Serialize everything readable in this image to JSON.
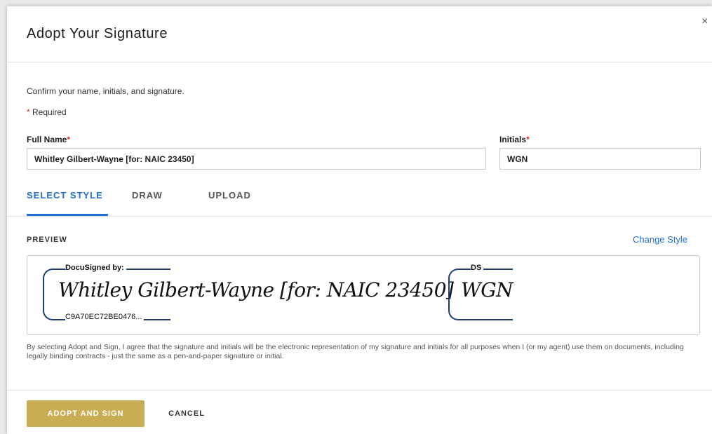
{
  "dialog": {
    "title": "Adopt Your Signature",
    "close_label": "×",
    "instructions": "Confirm your name, initials, and signature.",
    "required_star": "*",
    "required_label": " Required"
  },
  "form": {
    "full_name_label": "Full Name",
    "full_name_value": "Whitley Gilbert-Wayne [for: NAIC 23450]",
    "initials_label": "Initials",
    "initials_value": "WGN"
  },
  "tabs": [
    {
      "label": "SELECT STYLE",
      "active": true
    },
    {
      "label": "DRAW",
      "active": false
    },
    {
      "label": "UPLOAD",
      "active": false
    }
  ],
  "preview": {
    "label": "PREVIEW",
    "change_style": "Change Style",
    "signature_header": "DocuSigned by:",
    "signature_text": "Whitley Gilbert-Wayne [for: NAIC 23450]",
    "signature_code": "C9A70EC72BE0476...",
    "initials_header": "DS",
    "initials_text": "WGN"
  },
  "legal_text": "By selecting Adopt and Sign, I agree that the signature and initials will be the electronic representation of my signature and initials for all purposes when I (or my agent) use them on documents, including legally binding contracts - just the same as a pen-and-paper signature or initial.",
  "buttons": {
    "adopt": "ADOPT AND SIGN",
    "cancel": "CANCEL"
  },
  "colors": {
    "accent": "#1f6fd1",
    "adopt_button": "#c9ad55",
    "signature_frame": "#1c3f73",
    "required": "#cc2f2f"
  }
}
